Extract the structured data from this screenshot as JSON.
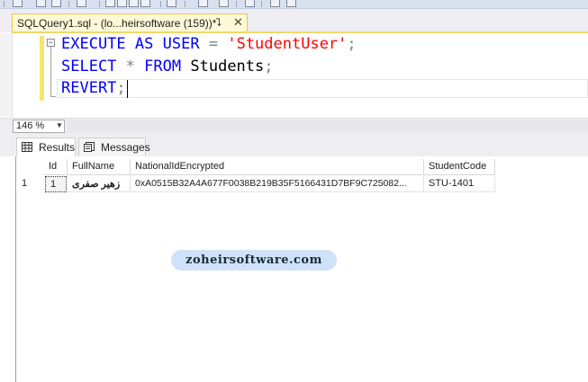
{
  "editor_tab": {
    "title": "SQLQuery1.sql - (lo...heirsoftware (159))*",
    "pin_icon": "pin-icon",
    "close_icon": "close-icon"
  },
  "editor": {
    "lines": [
      {
        "tokens": [
          "EXECUTE",
          "AS",
          "USER",
          "=",
          "'StudentUser'",
          ";"
        ]
      },
      {
        "tokens": [
          "SELECT",
          "*",
          "FROM",
          "Students",
          ";"
        ]
      },
      {
        "tokens": [
          "REVERT",
          ";"
        ]
      }
    ],
    "colors": {
      "keyword": "#0000ff",
      "string": "#ff0000",
      "operator": "#808080",
      "identifier": "#000000"
    }
  },
  "zoom": {
    "value": "146 %"
  },
  "results_tabs": [
    {
      "label": "Results",
      "icon": "grid-icon"
    },
    {
      "label": "Messages",
      "icon": "messages-icon"
    }
  ],
  "grid": {
    "columns": [
      "Id",
      "FullName",
      "NationalIdEncrypted",
      "StudentCode"
    ],
    "rows": [
      {
        "row_number": "1",
        "Id": "1",
        "FullName": "زهیر صفری",
        "NationalIdEncrypted": "0xA0515B32A4A677F0038B219B35F5166431D7BF9C725082...",
        "StudentCode": "STU-1401"
      }
    ]
  },
  "watermark": {
    "text": "zoheirsoftware.com",
    "background": "#cfe2f7"
  }
}
